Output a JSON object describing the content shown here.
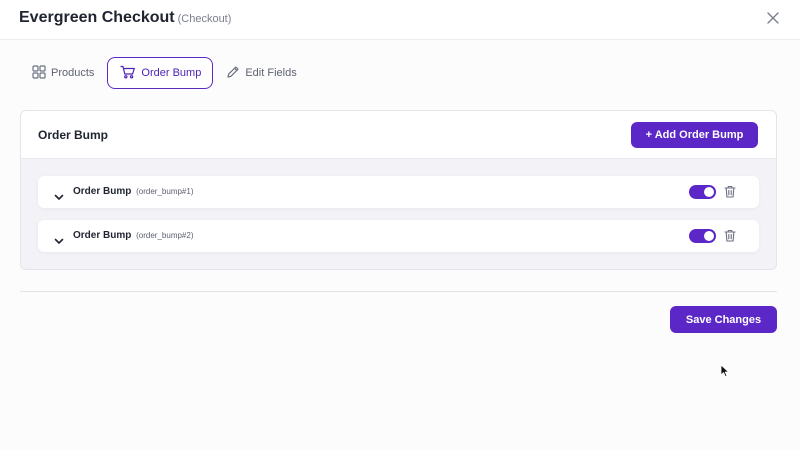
{
  "header": {
    "title": "Evergreen Checkout",
    "subtitle": "(Checkout)",
    "close_icon": "close-icon"
  },
  "tabs": [
    {
      "label": "Products",
      "icon": "grid-icon",
      "active": false
    },
    {
      "label": "Order Bump",
      "icon": "cart-icon",
      "active": true
    },
    {
      "label": "Edit Fields",
      "icon": "pencil-icon",
      "active": false
    }
  ],
  "panel": {
    "title": "Order Bump",
    "add_button_label": "+ Add Order Bump",
    "items": [
      {
        "name": "Order Bump",
        "id": "(order_bump#1)",
        "enabled": true
      },
      {
        "name": "Order Bump",
        "id": "(order_bump#2)",
        "enabled": true
      }
    ]
  },
  "footer": {
    "save_label": "Save Changes"
  },
  "colors": {
    "accent": "#5b27c7",
    "active_tab_border": "#5b2bc4",
    "panel_bg": "#f3f3f7"
  }
}
